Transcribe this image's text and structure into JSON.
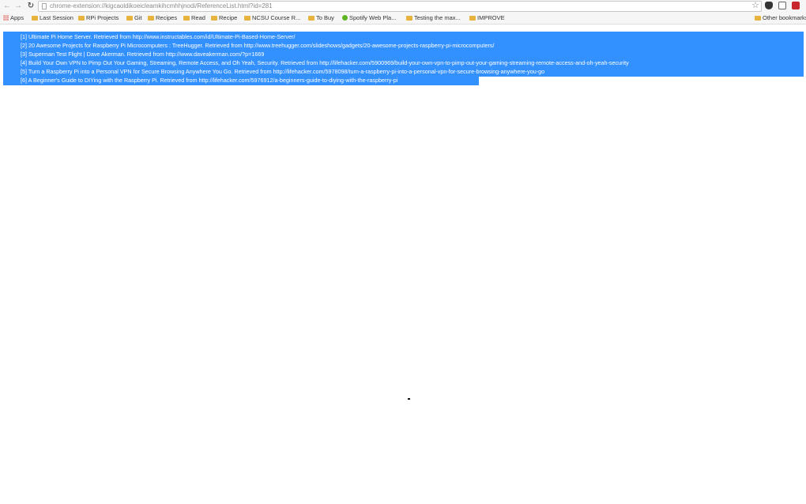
{
  "browser": {
    "url": "chrome-extension://kigcaoldikoeicleamkihcmhhjnodi/ReferenceList.html?id=281",
    "icons": {
      "back": "back-arrow-icon",
      "forward": "forward-arrow-icon",
      "reload": "reload-icon",
      "star": "star-icon"
    }
  },
  "bookmarks": {
    "items": [
      {
        "label": "Apps",
        "icon": "apps-grid-icon"
      },
      {
        "label": "Last Session",
        "icon": "folder-icon"
      },
      {
        "label": "RPi Projects",
        "icon": "folder-icon"
      },
      {
        "label": "Git",
        "icon": "folder-icon"
      },
      {
        "label": "Recipes",
        "icon": "folder-icon"
      },
      {
        "label": "Read",
        "icon": "folder-icon"
      },
      {
        "label": "Recipe",
        "icon": "folder-icon"
      },
      {
        "label": "NCSU Course R...",
        "icon": "folder-icon"
      },
      {
        "label": "To Buy",
        "icon": "folder-icon"
      },
      {
        "label": "Spotify Web Pla...",
        "icon": "spotify-icon"
      },
      {
        "label": "Testing the max...",
        "icon": "folder-icon"
      },
      {
        "label": "IMPROVE",
        "icon": "folder-icon"
      }
    ],
    "other": "Other bookmarks"
  },
  "references": [
    "[1] Ultimate Pi Home Server. Retrieved from http://www.instructables.com/id/Ultimate-Pi-Based-Home-Server/",
    "[2] 20 Awesome Projects for Raspberry Pi Microcomputers : TreeHugger. Retrieved from http://www.treehugger.com/slideshows/gadgets/20-awesome-projects-raspberry-pi-microcomputers/",
    "[3] Superman Test Flight | Dave Akerman. Retrieved from http://www.daveakerman.com/?p=1669",
    "[4] Build Your Own VPN to Pimp Out Your Gaming, Streaming, Remote Access, and Oh Yeah, Security. Retrieved from http://lifehacker.com/5900969/build-your-own-vpn-to-pimp-out-your-gaming-streaming-remote-access-and-oh-yeah-security",
    "[5] Turn a Raspberry Pi into a Personal VPN for Secure Browsing Anywhere You Go. Retrieved from http://lifehacker.com/5978098/turn-a-raspberry-pi-into-a-personal-vpn-for-secure-browsing-anywhere-you-go",
    "[6] A Beginner's Guide to DIYing with the Raspberry Pi. Retrieved from http://lifehacker.com/5976912/a-beginners-guide-to-diying-with-the-raspberry-pi"
  ],
  "colors": {
    "selection": "#3390ff",
    "selection_text": "#ffffff",
    "folder": "#e8b33c"
  }
}
